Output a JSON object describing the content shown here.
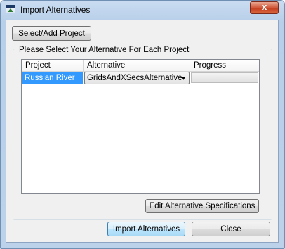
{
  "window": {
    "title": "Import Alternatives",
    "close_label": "x"
  },
  "toolbar": {
    "select_add_project_label": "Select/Add Project"
  },
  "group": {
    "label": "Please Select Your Alternative For Each Project"
  },
  "table": {
    "columns": [
      "Project",
      "Alternative",
      "Progress"
    ],
    "rows": [
      {
        "project": "Russian River",
        "alternative": "GridsAndXSecsAlternative",
        "progress": 0
      }
    ]
  },
  "actions": {
    "edit_specs_label": "Edit Alternative Specifications",
    "import_label": "Import Alternatives",
    "close_label": "Close"
  },
  "colors": {
    "selection": "#3399ff",
    "title_bar": "#c9dcf1",
    "close_button": "#c23b1f"
  }
}
